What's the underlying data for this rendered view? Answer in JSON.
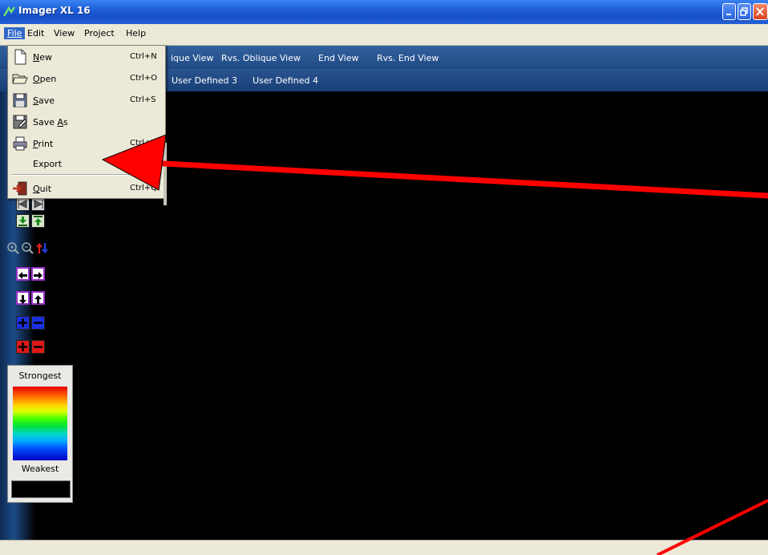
{
  "window": {
    "title": "Imager XL 16",
    "icon": "app-logo-icon"
  },
  "menubar": {
    "items": [
      {
        "name": "file",
        "label": "File",
        "underline": "F"
      },
      {
        "name": "edit",
        "label": "Edit",
        "underline": "E"
      },
      {
        "name": "view",
        "label": "View",
        "underline": "V"
      },
      {
        "name": "project",
        "label": "Project",
        "underline": "P"
      },
      {
        "name": "help",
        "label": "Help",
        "underline": "H"
      }
    ]
  },
  "view_tabs": {
    "row1": [
      "ique View",
      "Rvs. Oblique View",
      "End View",
      "Rvs. End View"
    ],
    "row2": [
      "User Defined 3",
      "User Defined 4"
    ]
  },
  "file_menu": {
    "items": [
      {
        "label_pre": "",
        "label_u": "N",
        "label_post": "ew",
        "shortcut": "Ctrl+N",
        "icon": "new-document-icon"
      },
      {
        "label_pre": "",
        "label_u": "O",
        "label_post": "pen",
        "shortcut": "Ctrl+O",
        "icon": "open-folder-icon"
      },
      {
        "label_pre": "",
        "label_u": "S",
        "label_post": "ave",
        "shortcut": "Ctrl+S",
        "icon": "save-disk-icon"
      },
      {
        "label_pre": "Save ",
        "label_u": "A",
        "label_post": "s",
        "shortcut": "",
        "icon": "save-as-icon"
      },
      {
        "label_pre": "",
        "label_u": "P",
        "label_post": "rint",
        "shortcut": "Ctrl+P",
        "icon": "printer-icon"
      },
      {
        "label_pre": "",
        "label_u": "",
        "label_post": "Export",
        "shortcut": "",
        "icon": "",
        "has_submenu": true
      },
      {
        "label_pre": "",
        "label_u": "Q",
        "label_post": "uit",
        "shortcut": "Ctrl+Q",
        "icon": "quit-door-icon"
      }
    ]
  },
  "legend": {
    "strong_label": "Strongest",
    "weak_label": "Weakest"
  },
  "colors": {
    "titlebar": "#1e5fd8",
    "menu_bg": "#ece9d8",
    "toolbar_blue": "#1f4a84",
    "canvas": "#000000",
    "annotation_arrow": "#ff0000"
  }
}
